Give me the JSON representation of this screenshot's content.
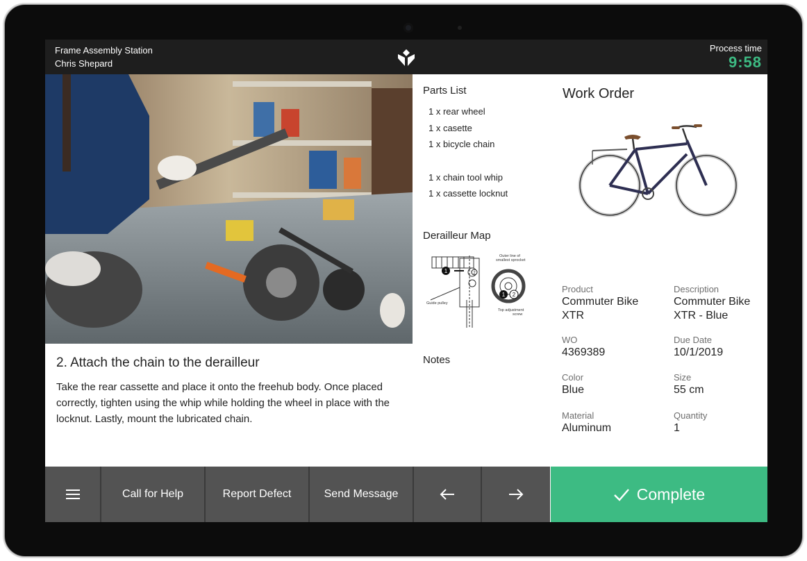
{
  "header": {
    "station": "Frame Assembly Station",
    "operator": "Chris Shepard",
    "process_time_label": "Process time",
    "process_time_value": "9:58"
  },
  "parts_list": {
    "title": "Parts List",
    "items": [
      "1 x rear wheel",
      "1 x casette",
      "1 x bicycle chain",
      "",
      "1 x chain tool whip",
      "1 x cassette locknut"
    ]
  },
  "derailleur_map": {
    "title": "Derailleur Map",
    "labels": [
      "Outer line of",
      "smallest sprocket",
      "Guide pulley",
      "Top adjustment",
      "screw"
    ]
  },
  "notes": {
    "title": "Notes"
  },
  "step": {
    "title": "2. Attach the chain to the derailleur",
    "body": "Take the rear cassette and place it onto the freehub body. Once placed correctly, tighten using the whip while holding the wheel in place with the locknut. Lastly, mount the lubricated chain."
  },
  "work_order": {
    "title": "Work Order",
    "fields": [
      {
        "label": "Product",
        "value": "Commuter Bike XTR"
      },
      {
        "label": "Description",
        "value": "Commuter Bike XTR - Blue"
      },
      {
        "label": "WO",
        "value": "4369389"
      },
      {
        "label": "Due Date",
        "value": "10/1/2019"
      },
      {
        "label": "Color",
        "value": "Blue"
      },
      {
        "label": "Size",
        "value": "55 cm"
      },
      {
        "label": "Material",
        "value": "Aluminum"
      },
      {
        "label": "Quantity",
        "value": "1"
      }
    ]
  },
  "toolbar": {
    "menu_icon": "hamburger-menu-icon",
    "call_help": "Call for Help",
    "report_defect": "Report Defect",
    "send_message": "Send Message",
    "back_icon": "arrow-left-icon",
    "next_icon": "arrow-right-icon",
    "complete": "Complete",
    "complete_icon": "checkmark-icon"
  },
  "colors": {
    "accent": "#3dbb83",
    "topbar": "#1e1e1e",
    "toolbar": "#535353"
  }
}
